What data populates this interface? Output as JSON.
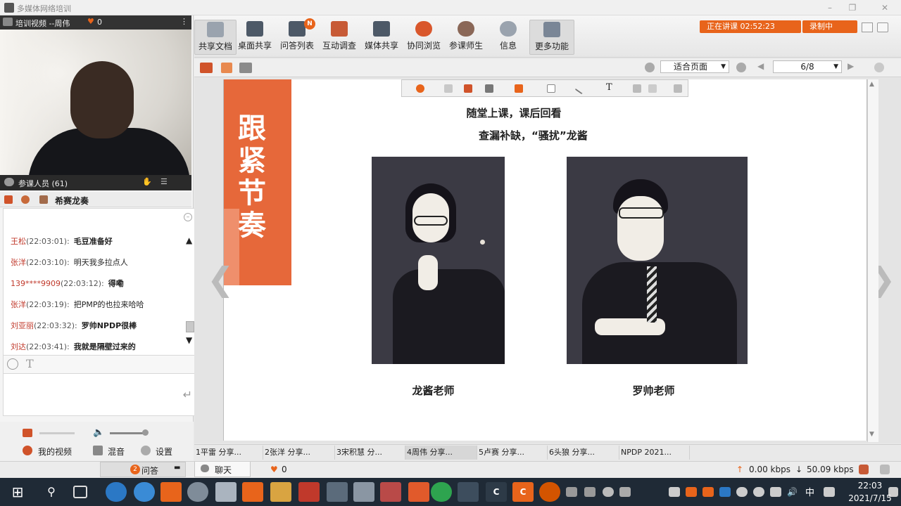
{
  "window": {
    "title": "多媒体网络培训",
    "controls": [
      "–",
      "❐",
      "✕"
    ]
  },
  "video_panel": {
    "header": "培训视频  --周伟",
    "likes": "0",
    "members_label": "参课人员 (61)",
    "group_name": "希赛龙奏"
  },
  "chat": {
    "messages": [
      {
        "name": "王松",
        "time": "(22:03:01):",
        "text": "毛豆准备好",
        "bold": true
      },
      {
        "name": "张洋",
        "time": "(22:03:10):",
        "text": "明天我多拉点人",
        "bold": false
      },
      {
        "name": "139****9909",
        "time": "(22:03:12):",
        "text": "得嘞",
        "bold": true
      },
      {
        "name": "张洋",
        "time": "(22:03:19):",
        "text": "把PMP的也拉来哈哈",
        "bold": false
      },
      {
        "name": "刘亚丽",
        "time": "(22:03:32):",
        "text": "罗帅NPDP很棒",
        "bold": true
      },
      {
        "name": "刘达",
        "time": "(22:03:41):",
        "text": "我就是隔壁过来的",
        "bold": true
      }
    ],
    "input_placeholder": ""
  },
  "media": {
    "my_video": "我的视频",
    "mix": "混音",
    "settings": "设置"
  },
  "toolbar": {
    "items": [
      {
        "label": "共享文档",
        "icon": "document-icon",
        "badge": ""
      },
      {
        "label": "桌面共享",
        "icon": "desktop-share-icon",
        "badge": ""
      },
      {
        "label": "问答列表",
        "icon": "qa-list-icon",
        "badge": "N"
      },
      {
        "label": "互动调查",
        "icon": "survey-icon",
        "badge": ""
      },
      {
        "label": "媒体共享",
        "icon": "media-share-icon",
        "badge": ""
      },
      {
        "label": "协同浏览",
        "icon": "co-browse-icon",
        "badge": ""
      },
      {
        "label": "参课师生",
        "icon": "participants-icon",
        "badge": ""
      },
      {
        "label": "信息",
        "icon": "info-icon",
        "badge": ""
      },
      {
        "label": "更多功能",
        "icon": "more-icon",
        "badge": ""
      }
    ],
    "status": "正在讲课 02:52:23",
    "recording": "录制中"
  },
  "doc_toolbar": {
    "zoom": "适合页面",
    "page": "6/8"
  },
  "slide": {
    "side_title": "跟紧节奏",
    "line1": "随堂上课，课后回看",
    "line2": "查漏补缺，“骚扰”龙酱",
    "caption_left": "龙酱老师",
    "caption_right": "罗帅老师"
  },
  "doc_tabs": [
    {
      "label": "1平雷 分享...",
      "active": false
    },
    {
      "label": "2张洋 分享...",
      "active": false
    },
    {
      "label": "3宋积慧 分...",
      "active": false
    },
    {
      "label": "4周伟 分享...",
      "active": true
    },
    {
      "label": "5卢赛 分享...",
      "active": false
    },
    {
      "label": "6头狼 分享...",
      "active": false
    },
    {
      "label": "NPDP 2021...",
      "active": false
    }
  ],
  "status_bar": {
    "qa": "问答",
    "qa_badge": "2",
    "chat": "聊天",
    "likes": "0",
    "upload": "0.00 kbps",
    "download": "50.09 kbps"
  },
  "taskbar": {
    "time": "22:03",
    "date": "2021/7/15",
    "ime": "中"
  },
  "colors": {
    "accent": "#e8641b",
    "slide_orange": "#e6683a",
    "photo_bg": "#3b3a44"
  }
}
